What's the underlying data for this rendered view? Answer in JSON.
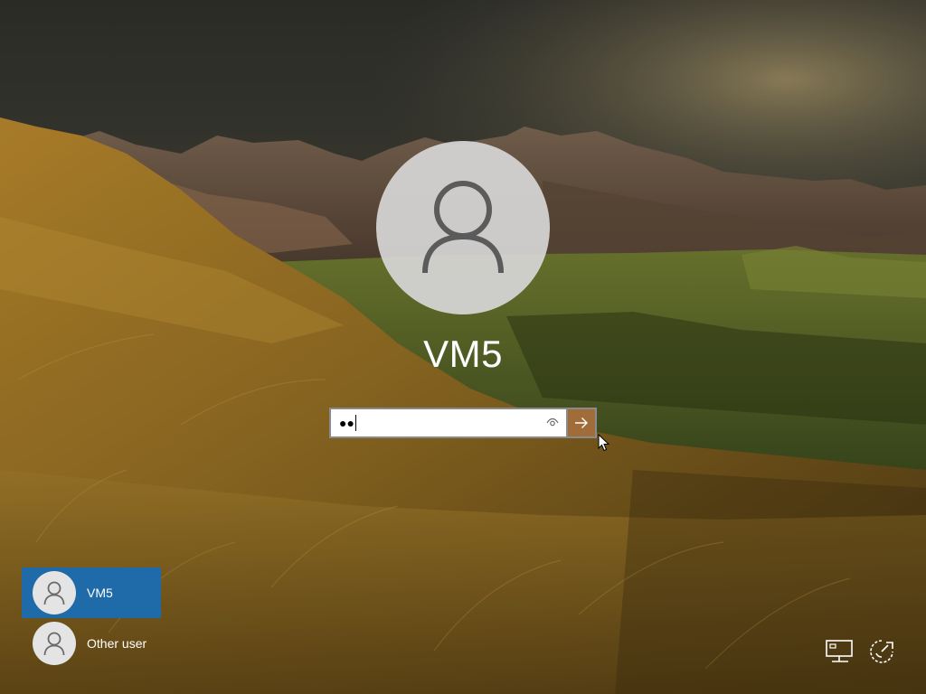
{
  "login": {
    "user_name": "VM5",
    "password_masked": "●●",
    "submit_icon": "arrow-right-icon",
    "reveal_icon": "eye-icon"
  },
  "users": [
    {
      "label": "VM5",
      "selected": true
    },
    {
      "label": "Other user",
      "selected": false
    }
  ],
  "system_icons": {
    "network": "network-icon",
    "accessibility": "ease-of-access-icon",
    "power": "power-icon"
  },
  "colors": {
    "selected_tile": "#1f6aa8",
    "submit_button": "#a06c3a",
    "avatar_bg": "#d7d7d7",
    "text": "#ffffff"
  }
}
